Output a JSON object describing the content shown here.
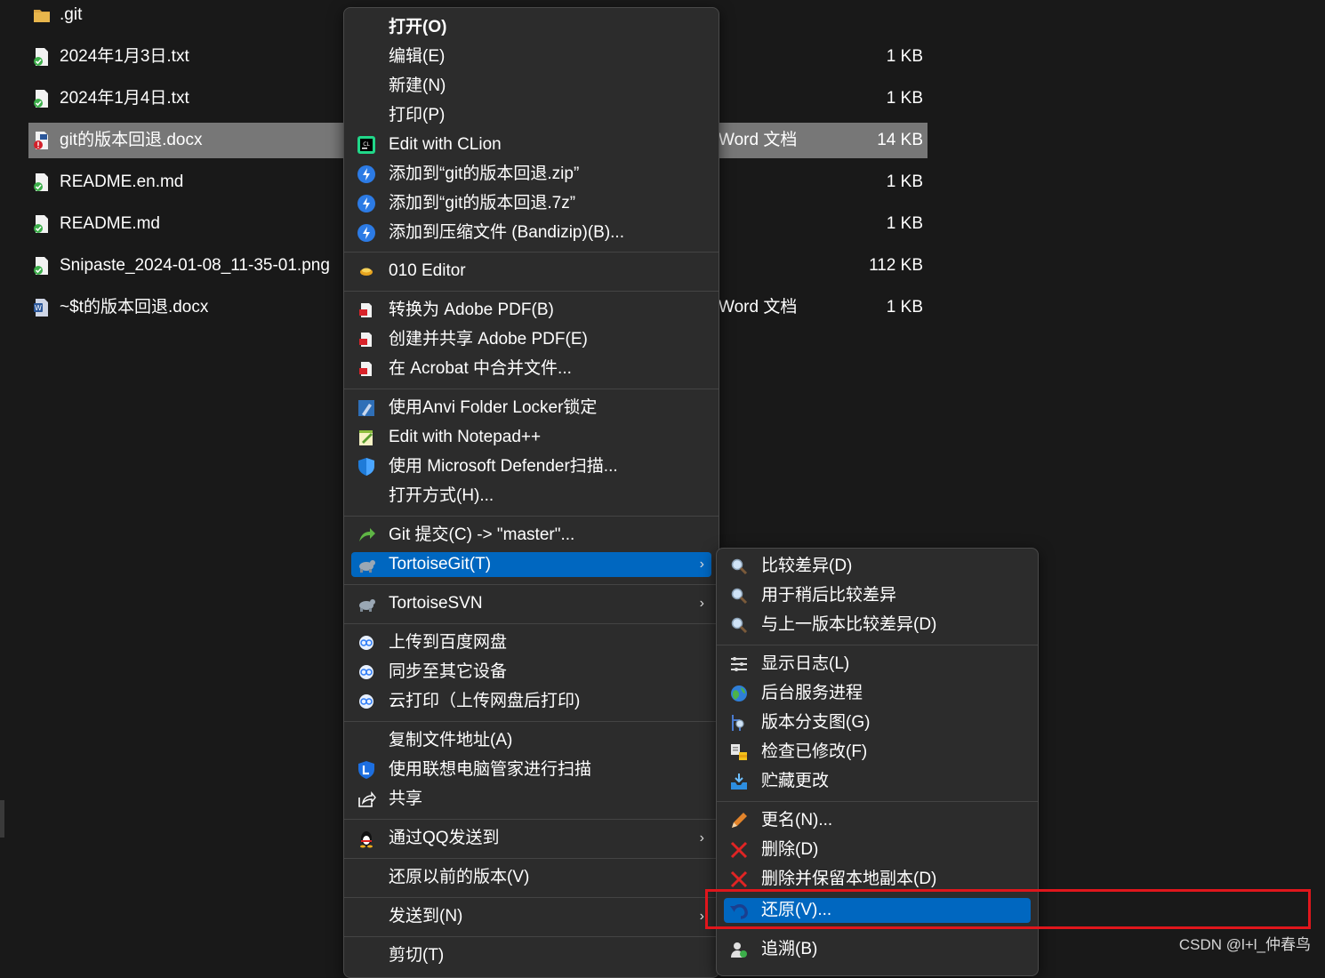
{
  "files": [
    {
      "name": ".git",
      "type": "",
      "size": "",
      "icon": "folder-icon"
    },
    {
      "name": "2024年1月3日.txt",
      "type": "",
      "size": "1 KB",
      "icon": "text-file-icon"
    },
    {
      "name": "2024年1月4日.txt",
      "type": "",
      "size": "1 KB",
      "icon": "text-file-icon"
    },
    {
      "name": "git的版本回退.docx",
      "type": "Word 文档",
      "size": "14 KB",
      "icon": "conflict-docx-icon",
      "selected": true
    },
    {
      "name": "README.en.md",
      "type": "",
      "size": "1 KB",
      "icon": "text-file-icon"
    },
    {
      "name": "README.md",
      "type": "",
      "size": "1 KB",
      "icon": "text-file-icon"
    },
    {
      "name": "Snipaste_2024-01-08_11-35-01.png",
      "type": "",
      "size": "112 KB",
      "icon": "image-file-icon"
    },
    {
      "name": "~$t的版本回退.docx",
      "type": "Word 文档",
      "size": "1 KB",
      "icon": "word-file-icon"
    }
  ],
  "context_menu": {
    "items": [
      {
        "label": "打开(O)",
        "icon": "",
        "bold": true
      },
      {
        "label": "编辑(E)",
        "icon": ""
      },
      {
        "label": "新建(N)",
        "icon": ""
      },
      {
        "label": "打印(P)",
        "icon": ""
      },
      {
        "label": "Edit with CLion",
        "icon": "clion-icon"
      },
      {
        "label": "添加到“git的版本回退.zip”",
        "icon": "bandizip-icon"
      },
      {
        "label": "添加到“git的版本回退.7z”",
        "icon": "bandizip-icon"
      },
      {
        "label": "添加到压缩文件 (Bandizip)(B)...",
        "icon": "bandizip-icon"
      },
      {
        "label": "010 Editor",
        "icon": "010-editor-icon"
      },
      {
        "label": "转换为 Adobe PDF(B)",
        "icon": "acrobat-icon"
      },
      {
        "label": "创建并共享 Adobe PDF(E)",
        "icon": "acrobat-icon"
      },
      {
        "label": "在 Acrobat 中合并文件...",
        "icon": "acrobat-icon"
      },
      {
        "label": "使用Anvi Folder Locker锁定",
        "icon": "folder-locker-icon"
      },
      {
        "label": "Edit with Notepad++",
        "icon": "notepad-plus-plus-icon"
      },
      {
        "label": "使用 Microsoft Defender扫描...",
        "icon": "defender-shield-icon"
      },
      {
        "label": "打开方式(H)...",
        "icon": ""
      },
      {
        "label": "Git 提交(C) -> \"master\"...",
        "icon": "git-commit-icon"
      },
      {
        "label": "TortoiseGit(T)",
        "icon": "tortoisegit-icon",
        "highlight": true,
        "submenu": true
      },
      {
        "label": "TortoiseSVN",
        "icon": "tortoisesvn-icon",
        "submenu": true
      },
      {
        "label": "上传到百度网盘",
        "icon": "baidu-netdisk-icon"
      },
      {
        "label": "同步至其它设备",
        "icon": "baidu-netdisk-icon"
      },
      {
        "label": "云打印（上传网盘后打印)",
        "icon": "baidu-netdisk-icon"
      },
      {
        "label": "复制文件地址(A)",
        "icon": ""
      },
      {
        "label": "使用联想电脑管家进行扫描",
        "icon": "lenovo-shield-icon"
      },
      {
        "label": "共享",
        "icon": "share-icon"
      },
      {
        "label": "通过QQ发送到",
        "icon": "qq-penguin-icon",
        "submenu": true
      },
      {
        "label": "还原以前的版本(V)",
        "icon": ""
      },
      {
        "label": "发送到(N)",
        "icon": "",
        "submenu": true
      },
      {
        "label": "剪切(T)",
        "icon": ""
      }
    ]
  },
  "tortoisegit_submenu": {
    "items": [
      {
        "label": "比较差异(D)",
        "icon": "magnifier-icon"
      },
      {
        "label": "用于稍后比较差异",
        "icon": "magnifier-icon"
      },
      {
        "label": "与上一版本比较差异(D)",
        "icon": "magnifier-icon"
      },
      {
        "label": "显示日志(L)",
        "icon": "log-list-icon"
      },
      {
        "label": "后台服务进程",
        "icon": "globe-icon"
      },
      {
        "label": "版本分支图(G)",
        "icon": "revision-graph-icon"
      },
      {
        "label": "检查已修改(F)",
        "icon": "check-modifications-icon"
      },
      {
        "label": "贮藏更改",
        "icon": "stash-icon"
      },
      {
        "label": "更名(N)...",
        "icon": "pencil-icon"
      },
      {
        "label": "删除(D)",
        "icon": "red-x-icon"
      },
      {
        "label": "删除并保留本地副本(D)",
        "icon": "red-x-icon"
      },
      {
        "label": "还原(V)...",
        "icon": "revert-arrow-icon",
        "highlight": true
      },
      {
        "label": "追溯(B)",
        "icon": "blame-icon"
      }
    ]
  },
  "watermark": "CSDN @l+l_仲春鸟",
  "colors": {
    "accent": "#0067c0",
    "annotation": "#e0161c",
    "background": "#191919",
    "menu": "#2c2c2c"
  }
}
